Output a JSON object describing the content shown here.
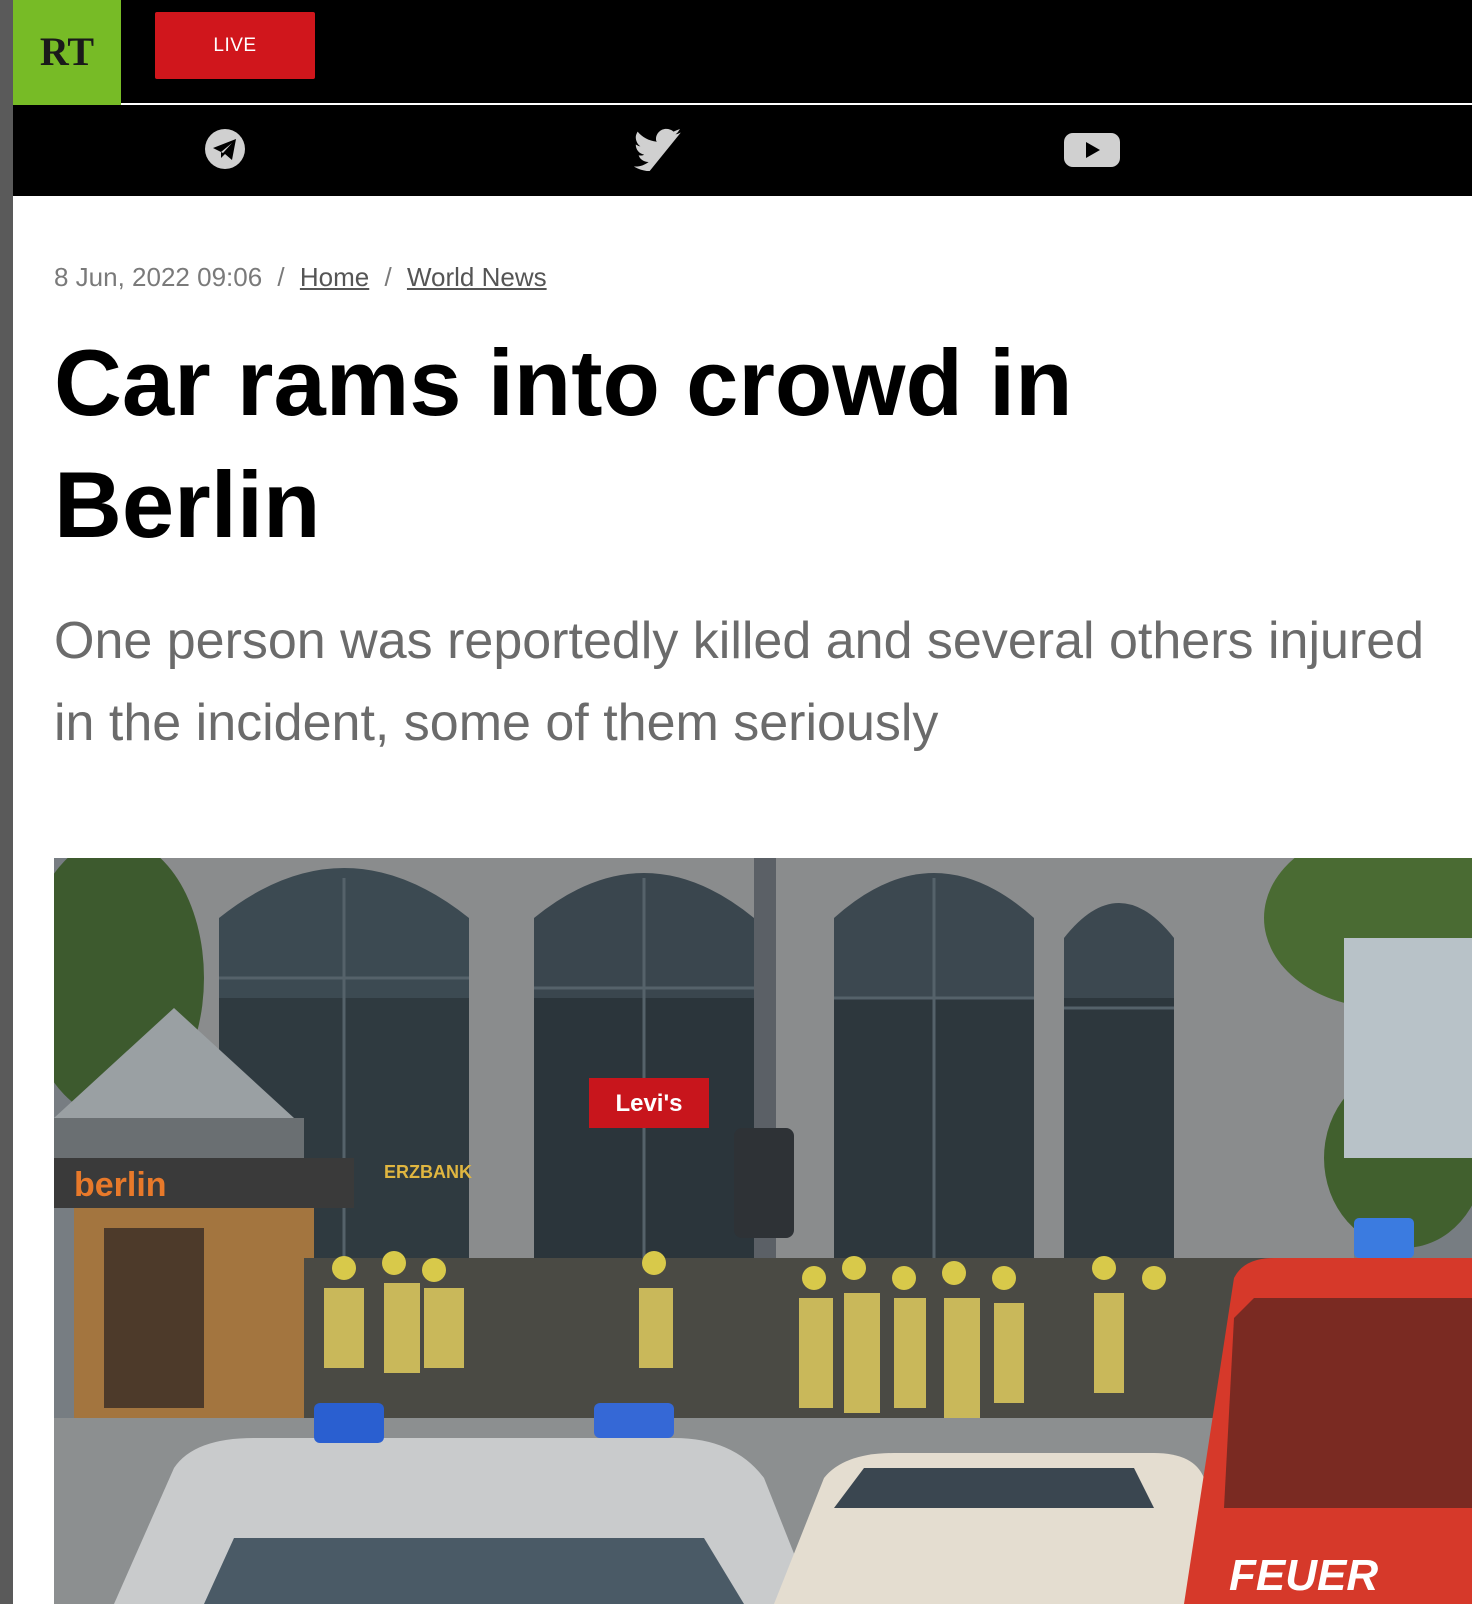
{
  "header": {
    "logo_text": "RT",
    "live_label": "LIVE",
    "brand_color": "#77bb26",
    "live_color": "#d0161c"
  },
  "social": {
    "icons": [
      "telegram-icon",
      "twitter-icon",
      "youtube-icon"
    ]
  },
  "article": {
    "date": "8 Jun, 2022 09:06",
    "breadcrumb": [
      "Home",
      "World News"
    ],
    "title": "Car rams into crowd in Berlin",
    "summary": "One person was reportedly killed and several others injured in the incident, some of them seriously"
  },
  "photo": {
    "sign_levis": "Levi's",
    "sign_berlin": "berlin",
    "sign_bank": "ERZBANK",
    "truck_text": "FEUER"
  }
}
